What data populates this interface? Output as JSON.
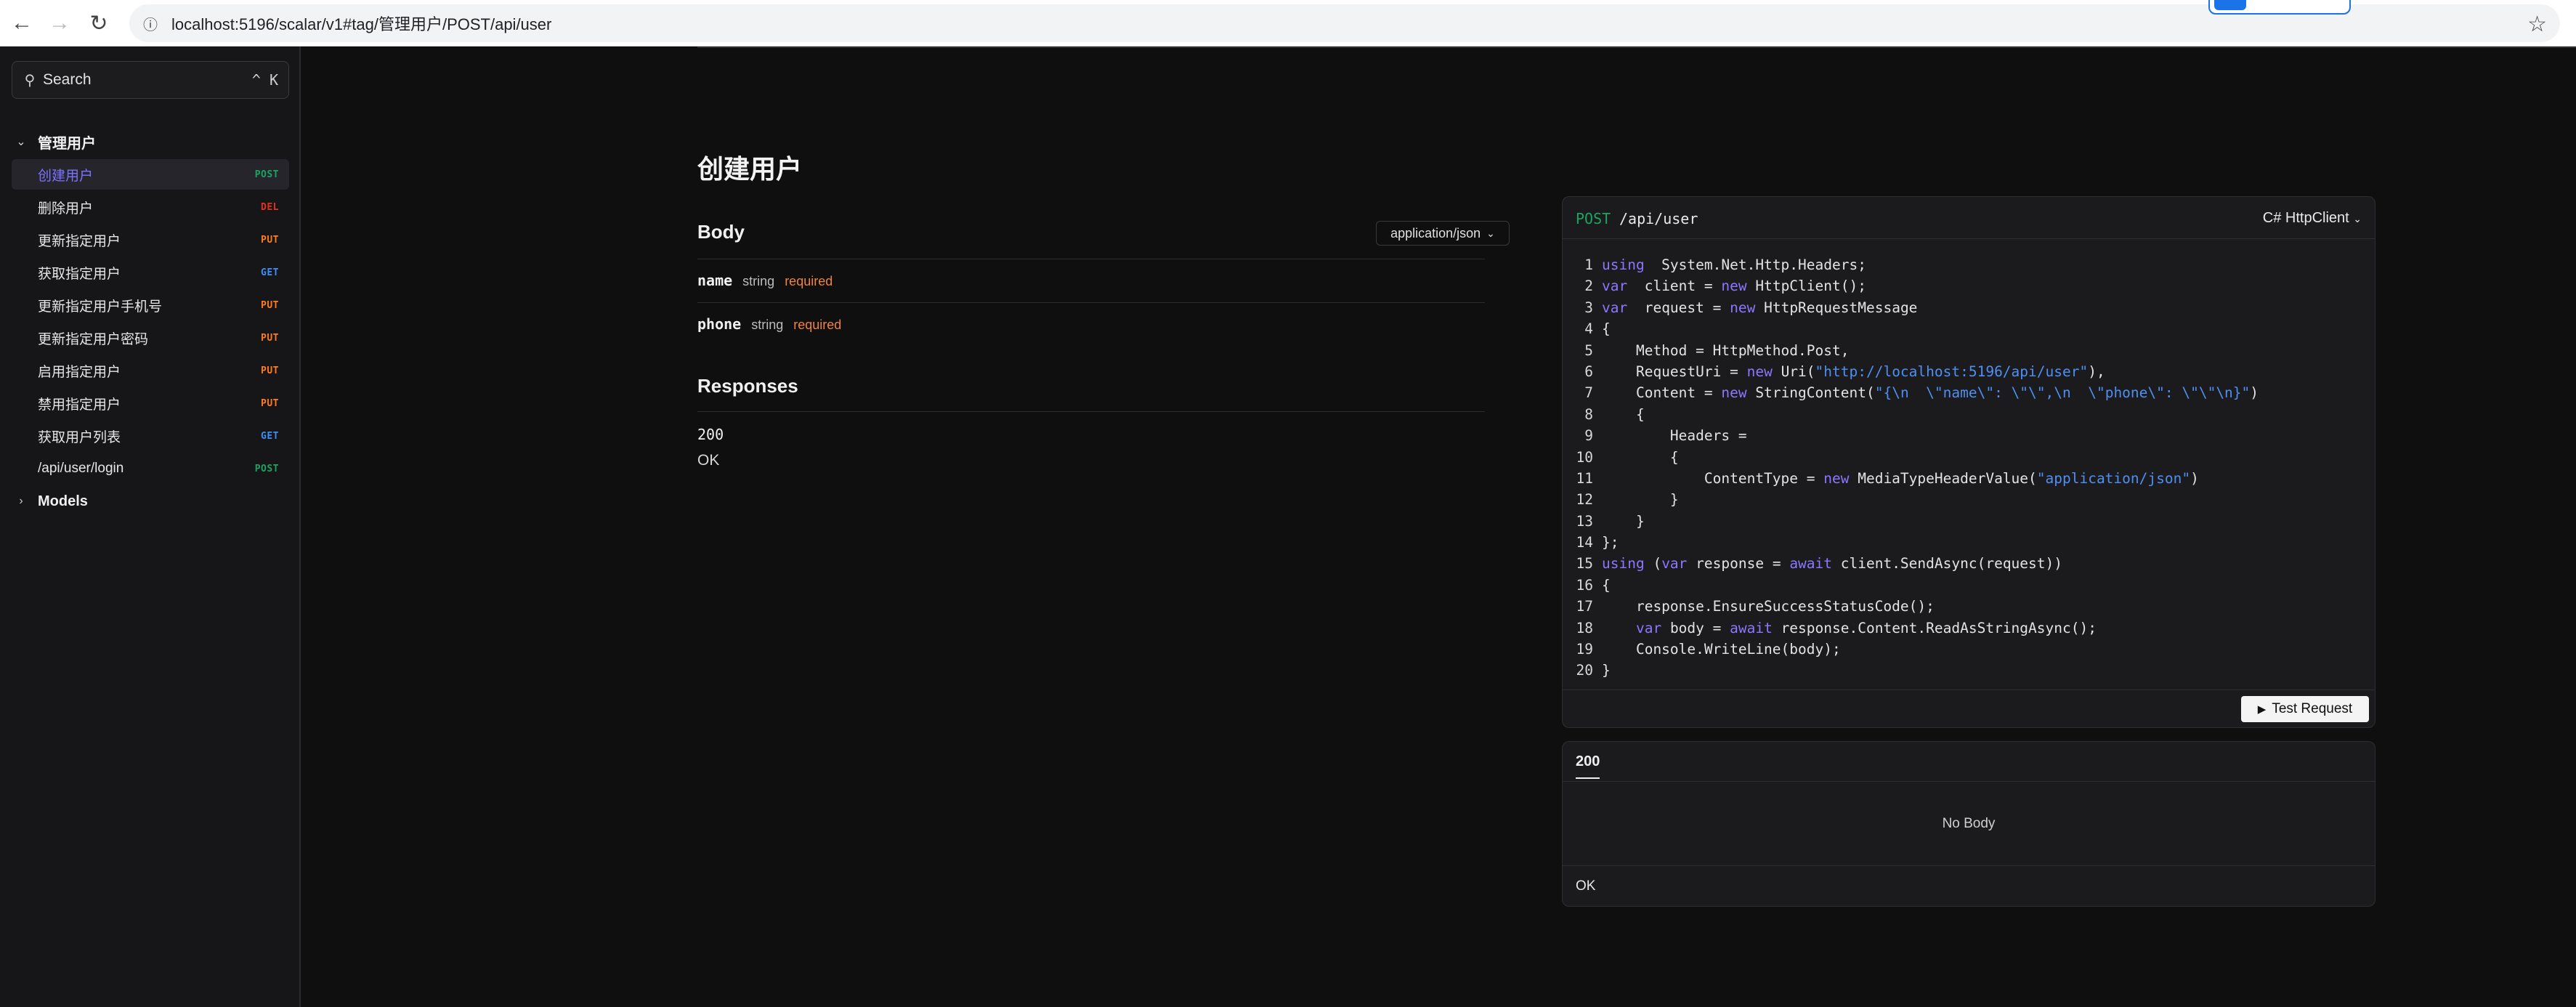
{
  "browser": {
    "url": "localhost:5196/scalar/v1#tag/管理用户/POST/api/user"
  },
  "sidebar": {
    "search_placeholder": "Search",
    "search_shortcut": "^ K",
    "group_label": "管理用户",
    "items": [
      {
        "label": "创建用户",
        "method": "POST"
      },
      {
        "label": "删除用户",
        "method": "DEL"
      },
      {
        "label": "更新指定用户",
        "method": "PUT"
      },
      {
        "label": "获取指定用户",
        "method": "GET"
      },
      {
        "label": "更新指定用户手机号",
        "method": "PUT"
      },
      {
        "label": "更新指定用户密码",
        "method": "PUT"
      },
      {
        "label": "启用指定用户",
        "method": "PUT"
      },
      {
        "label": "禁用指定用户",
        "method": "PUT"
      },
      {
        "label": "获取用户列表",
        "method": "GET"
      },
      {
        "label": "/api/user/login",
        "method": "POST"
      }
    ],
    "models_label": "Models"
  },
  "operation": {
    "title": "创建用户",
    "body_title": "Body",
    "content_type": "application/json",
    "params": [
      {
        "name": "name",
        "type": "string",
        "required": "required"
      },
      {
        "name": "phone",
        "type": "string",
        "required": "required"
      }
    ],
    "responses_title": "Responses",
    "response_code": "200",
    "response_desc": "OK"
  },
  "code_panel": {
    "method": "POST",
    "path": "/api/user",
    "language": "C# HttpClient",
    "lines": [
      [
        [
          "kw",
          "using"
        ],
        [
          "",
          "  System.Net.Http.Headers;"
        ]
      ],
      [
        [
          "kw",
          "var"
        ],
        [
          "",
          "  client = "
        ],
        [
          "kw",
          "new"
        ],
        [
          "",
          " HttpClient();"
        ]
      ],
      [
        [
          "kw",
          "var"
        ],
        [
          "",
          "  request = "
        ],
        [
          "kw",
          "new"
        ],
        [
          "",
          " HttpRequestMessage"
        ]
      ],
      [
        [
          "",
          "{"
        ]
      ],
      [
        [
          "",
          "    Method = HttpMethod.Post,"
        ]
      ],
      [
        [
          "",
          "    RequestUri = "
        ],
        [
          "kw",
          "new"
        ],
        [
          "",
          " Uri("
        ],
        [
          "str",
          "\"http://localhost:5196/api/user\""
        ],
        [
          "",
          "),"
        ]
      ],
      [
        [
          "",
          "    Content = "
        ],
        [
          "kw",
          "new"
        ],
        [
          "",
          " StringContent("
        ],
        [
          "str",
          "\"{\\n  \\\"name\\\": \\\"\\\",\\n  \\\"phone\\\": \\\"\\\"\\n}\""
        ],
        [
          "",
          ")"
        ]
      ],
      [
        [
          "",
          "    {"
        ]
      ],
      [
        [
          "",
          "        Headers ="
        ]
      ],
      [
        [
          "",
          "        {"
        ]
      ],
      [
        [
          "",
          "            ContentType = "
        ],
        [
          "kw",
          "new"
        ],
        [
          "",
          " MediaTypeHeaderValue("
        ],
        [
          "str",
          "\"application/json\""
        ],
        [
          "",
          ")"
        ]
      ],
      [
        [
          "",
          "        }"
        ]
      ],
      [
        [
          "",
          "    }"
        ]
      ],
      [
        [
          "",
          "};"
        ]
      ],
      [
        [
          "kw",
          "using"
        ],
        [
          "",
          " ("
        ],
        [
          "kw",
          "var"
        ],
        [
          "",
          " response = "
        ],
        [
          "kw",
          "await"
        ],
        [
          "",
          " client.SendAsync(request))"
        ]
      ],
      [
        [
          "",
          "{"
        ]
      ],
      [
        [
          "",
          "    response.EnsureSuccessStatusCode();"
        ]
      ],
      [
        [
          "",
          "    "
        ],
        [
          "kw",
          "var"
        ],
        [
          "",
          " body = "
        ],
        [
          "kw",
          "await"
        ],
        [
          "",
          " response.Content.ReadAsStringAsync();"
        ]
      ],
      [
        [
          "",
          "    Console.WriteLine(body);"
        ]
      ],
      [
        [
          "",
          "}"
        ]
      ]
    ],
    "test_button_label": "Test Request"
  },
  "response_panel": {
    "tab": "200",
    "empty_text": "No Body",
    "status_text": "OK"
  }
}
